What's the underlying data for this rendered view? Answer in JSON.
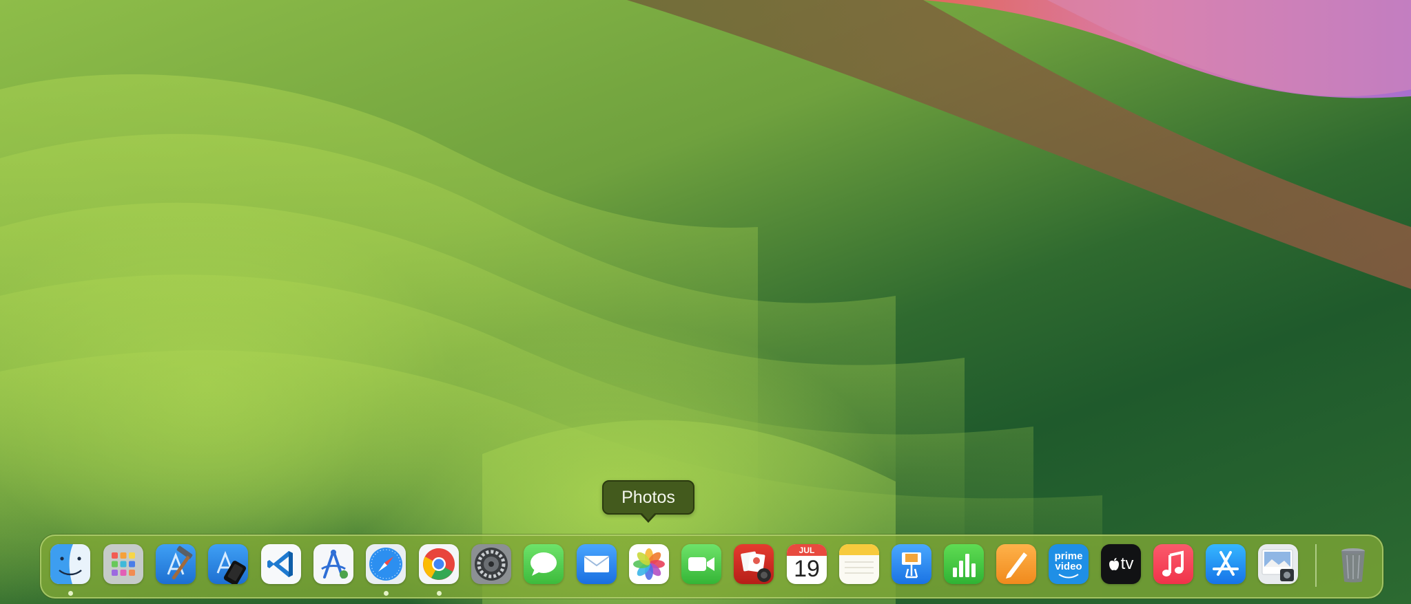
{
  "tooltip": {
    "text": "Photos"
  },
  "dock": {
    "items": [
      {
        "id": "finder",
        "icon": "finder-icon",
        "running": true
      },
      {
        "id": "launchpad",
        "icon": "launchpad-icon",
        "running": false
      },
      {
        "id": "xcode",
        "icon": "xcode-icon",
        "running": false
      },
      {
        "id": "simulator",
        "icon": "simulator-icon",
        "running": false
      },
      {
        "id": "vscode",
        "icon": "vscode-icon",
        "running": false
      },
      {
        "id": "instruments",
        "icon": "instruments-icon",
        "running": false
      },
      {
        "id": "safari",
        "icon": "safari-icon",
        "running": true
      },
      {
        "id": "chrome",
        "icon": "chrome-icon",
        "running": true
      },
      {
        "id": "system-settings",
        "icon": "gear-icon",
        "running": false
      },
      {
        "id": "messages",
        "icon": "messages-icon",
        "running": false
      },
      {
        "id": "mail",
        "icon": "mail-icon",
        "running": false
      },
      {
        "id": "photos",
        "icon": "photos-icon",
        "running": false
      },
      {
        "id": "facetime",
        "icon": "facetime-icon",
        "running": false
      },
      {
        "id": "photo-booth",
        "icon": "photo-booth-icon",
        "running": false
      },
      {
        "id": "calendar",
        "icon": "calendar-icon",
        "running": false,
        "month": "JUL",
        "day": "19"
      },
      {
        "id": "notes",
        "icon": "notes-icon",
        "running": false
      },
      {
        "id": "keynote",
        "icon": "keynote-icon",
        "running": false
      },
      {
        "id": "numbers",
        "icon": "numbers-icon",
        "running": false
      },
      {
        "id": "pages",
        "icon": "pages-icon",
        "running": false
      },
      {
        "id": "prime-video",
        "icon": "prime-video-icon",
        "running": false,
        "line1": "prime",
        "line2": "video"
      },
      {
        "id": "apple-tv",
        "icon": "apple-tv-icon",
        "running": false,
        "label": "tv"
      },
      {
        "id": "music",
        "icon": "music-icon",
        "running": false
      },
      {
        "id": "app-store",
        "icon": "app-store-icon",
        "running": false
      },
      {
        "id": "preview",
        "icon": "preview-icon",
        "running": false
      },
      {
        "id": "trash",
        "icon": "trash-icon",
        "running": false
      }
    ]
  },
  "colors": {
    "accent_pink": "#d97aa8",
    "tooltip_bg": "#435a1d",
    "running_dot": "#e4f3c6"
  }
}
